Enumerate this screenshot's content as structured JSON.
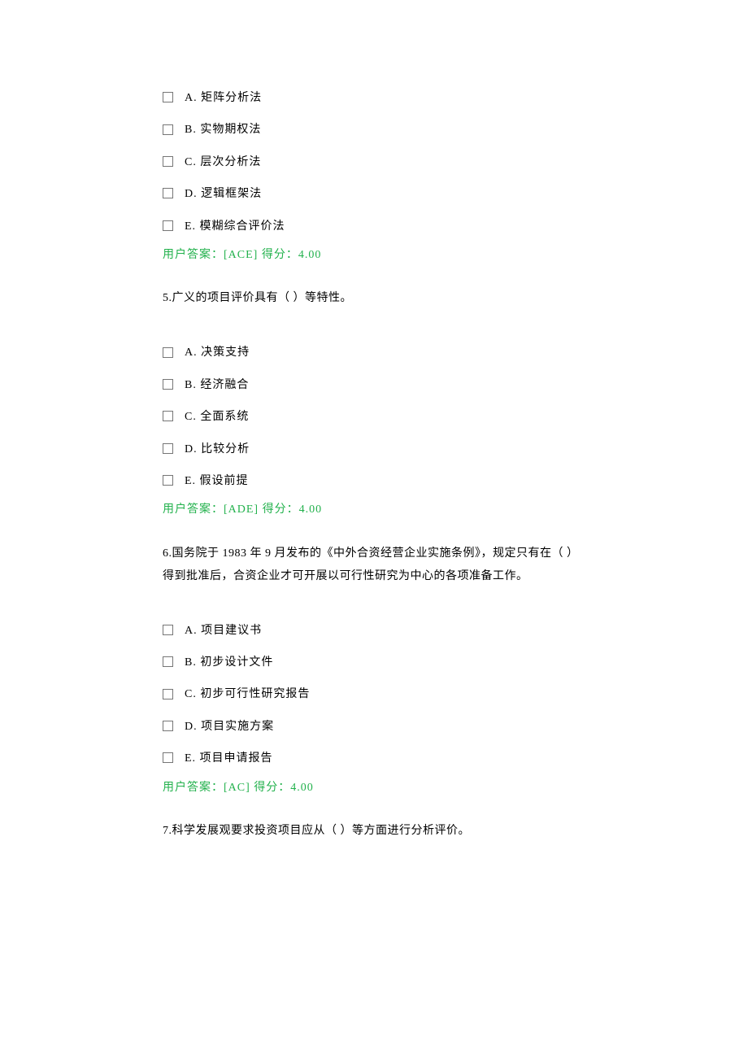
{
  "questions": [
    {
      "options": [
        "A. 矩阵分析法",
        "B. 实物期权法",
        "C. 层次分析法",
        "D. 逻辑框架法",
        "E. 模糊综合评价法"
      ],
      "answer": "用户答案：[ACE] 得分：4.00"
    },
    {
      "text": "5.广义的项目评价具有（ ）等特性。",
      "options": [
        "A. 决策支持",
        "B. 经济融合",
        "C. 全面系统",
        "D. 比较分析",
        "E. 假设前提"
      ],
      "answer": "用户答案：[ADE] 得分：4.00"
    },
    {
      "text": "6.国务院于 1983 年 9 月发布的《中外合资经营企业实施条例》，规定只有在（ ）得到批准后，合资企业才可开展以可行性研究为中心的各项准备工作。",
      "options": [
        "A. 项目建议书",
        "B. 初步设计文件",
        "C. 初步可行性研究报告",
        "D. 项目实施方案",
        "E. 项目申请报告"
      ],
      "answer": "用户答案：[AC] 得分：4.00"
    },
    {
      "text": "7.科学发展观要求投资项目应从（ ）等方面进行分析评价。"
    }
  ]
}
